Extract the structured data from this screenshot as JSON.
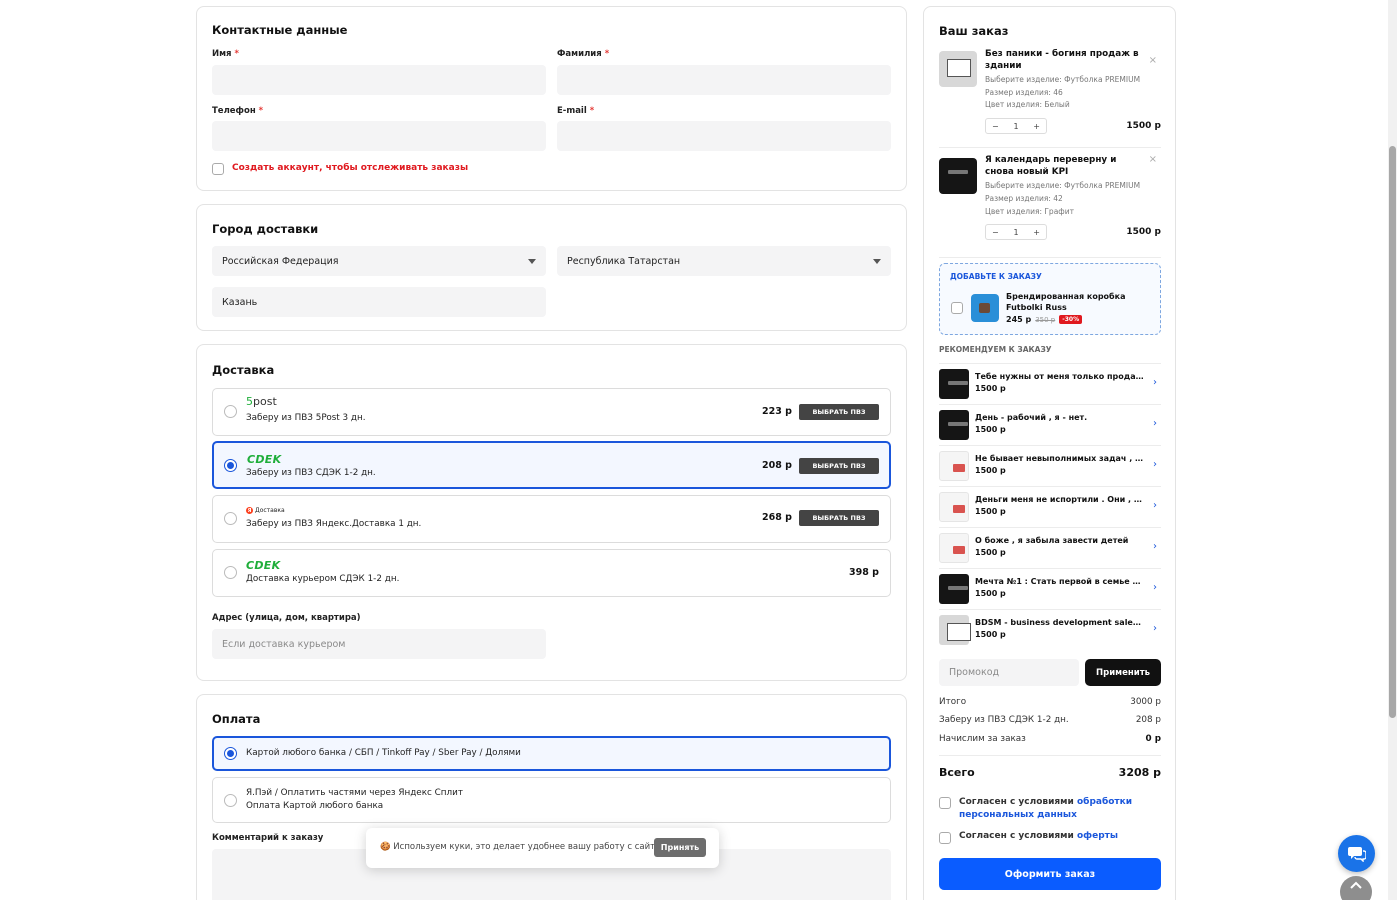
{
  "contacts": {
    "title": "Контактные данные",
    "first_name_label": "Имя",
    "last_name_label": "Фамилия",
    "phone_label": "Телефон",
    "email_label": "E-mail",
    "required_mark": "*",
    "create_account_label": "Создать аккаунт, чтобы отслеживать заказы"
  },
  "city": {
    "title": "Город доставки",
    "country": "Российская Федерация",
    "region": "Республика Татарстан",
    "city": "Казань"
  },
  "delivery": {
    "title": "Доставка",
    "choose_pvz": "ВЫБРАТЬ ПВЗ",
    "options": [
      {
        "logo": "5post",
        "desc": "Заберу из ПВЗ 5Post 3 дн.",
        "price": "223 р"
      },
      {
        "logo": "CDEK",
        "desc": "Заберу из ПВЗ СДЭК 1-2 дн.",
        "price": "208 р"
      },
      {
        "logo": "Яндекс Доставка",
        "desc": "Заберу из ПВЗ Яндекс.Доставка 1 дн.",
        "price": "268 р"
      },
      {
        "logo": "CDEK",
        "desc": "Доставка курьером СДЭК 1-2 дн.",
        "price": "398 р"
      }
    ],
    "logo_5post_digit": "5",
    "logo_5post_word": "post",
    "logo_ya_letter": "Я",
    "logo_ya_word": "Доставка",
    "logo_cdek": "CDEK",
    "address_label": "Адрес (улица, дом, квартира)",
    "address_placeholder": "Если доставка курьером"
  },
  "payment": {
    "title": "Оплата",
    "option1": "Картой любого банка / СБП / Tinkoff Pay / Sber Pay / Долями",
    "option2_line1": "Я.Пэй / Оплатить частями через Яндекс Сплит",
    "option2_line2": "Оплата Картой любого банка",
    "comment_label": "Комментарий к заказу"
  },
  "order": {
    "title": "Ваш заказ",
    "items": [
      {
        "name": "Без паники - богиня продаж в здании",
        "product": "Выберите изделие: Футболка PREMIUM",
        "size": "Размер изделия: 46",
        "color": "Цвет изделия: Белый",
        "qty": "1",
        "price": "1500 р"
      },
      {
        "name": "Я календарь переверну и снова новый KPI",
        "product": "Выберите изделие: Футболка PREMIUM",
        "size": "Размер изделия: 42",
        "color": "Цвет изделия: Графит",
        "qty": "1",
        "price": "1500 р"
      }
    ],
    "minus": "−",
    "plus": "+",
    "close": "×",
    "addon": {
      "header": "ДОБАВЬТЕ К ЗАКАЗУ",
      "name": "Брендированная коробка Futbolki Russ",
      "price": "245 р",
      "old_price": "350 р",
      "discount": "-30%"
    },
    "recommend_title": "РЕКОМЕНДУЕМ К ЗАКАЗУ",
    "recommendations": [
      {
        "name": "Тебе нужны от меня только продажи",
        "price": "1500 р"
      },
      {
        "name": "День - рабочий , я - нет.",
        "price": "1500 р"
      },
      {
        "name": "Не бывает невыполнимых задач , …",
        "price": "1500 р"
      },
      {
        "name": "Деньги меня не испортили . Они , с…",
        "price": "1500 р"
      },
      {
        "name": "О боже , я забыла завести детей",
        "price": "1500 р"
      },
      {
        "name": "Мечта №1 : Стать первой в семье м…",
        "price": "1500 р"
      },
      {
        "name": "BDSM - business development sales …",
        "price": "1500 р"
      }
    ],
    "arrow": "›",
    "promo_placeholder": "Промокод",
    "apply_label": "Применить",
    "subtotal_label": "Итого",
    "subtotal_value": "3000 р",
    "shipping_label": "Заберу из ПВЗ СДЭК 1-2 дн.",
    "shipping_value": "208 р",
    "bonus_label": "Начислим за заказ",
    "bonus_value": "0 р",
    "total_label": "Всего",
    "total_value": "3208 р",
    "agree_prefix": "Согласен с условиями",
    "agree_pd_link": "обработки персональных данных",
    "agree_offer_link": "оферты",
    "submit_label": "Оформить заказ"
  },
  "cookie": {
    "emoji": "🍪",
    "text": "Используем куки, это делает удобнее вашу работу с сайтом",
    "accept_label": "Принять"
  },
  "chat_icon": "chat-bubbles-icon",
  "top_icon": "chevron-up-icon",
  "colors": {
    "accent": "#1a56db",
    "primary_button": "#0a5cff",
    "dark_button": "#111111",
    "required": "#e53935",
    "cdek_green": "#1fae3a"
  }
}
